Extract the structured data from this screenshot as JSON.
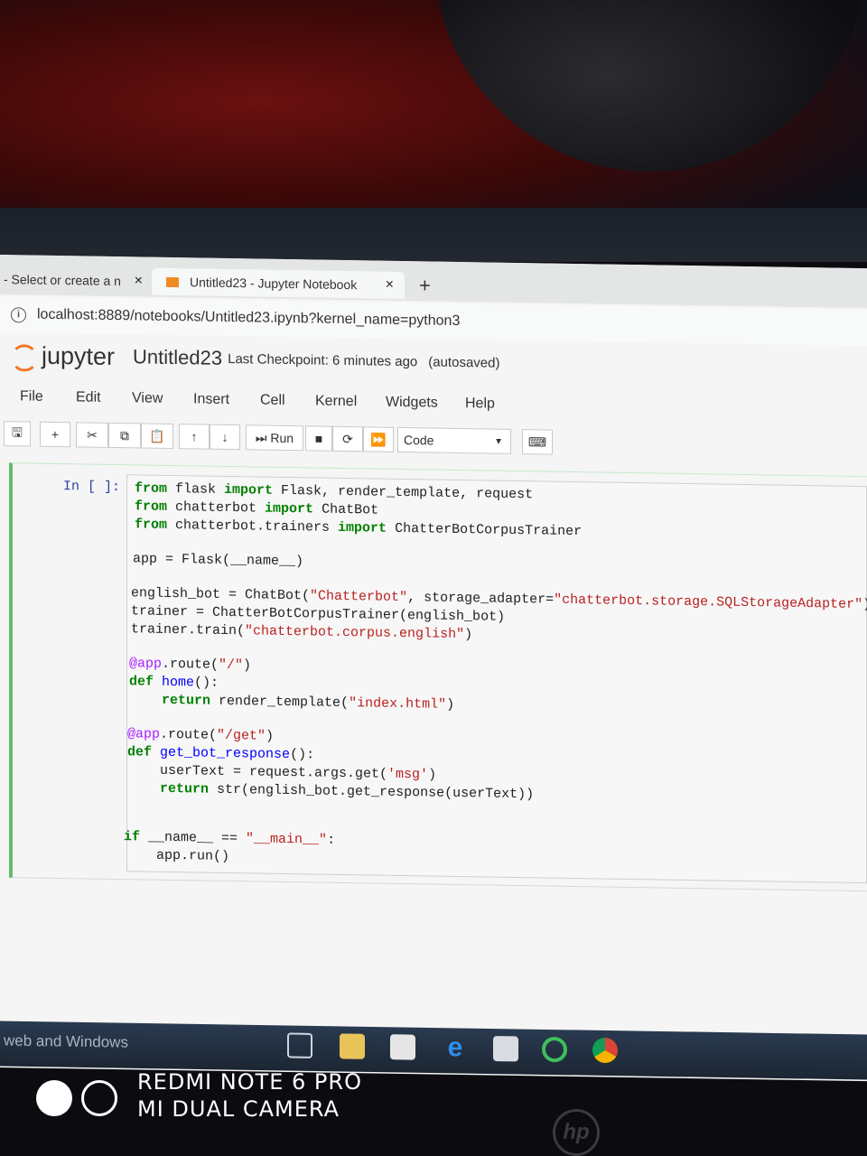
{
  "browser": {
    "tabs": [
      {
        "label": "- Select or create a n",
        "close": "×"
      },
      {
        "label": "Untitled23 - Jupyter Notebook",
        "close": "×"
      }
    ],
    "new_tab": "+",
    "url": "localhost:8889/notebooks/Untitled23.ipynb?kernel_name=python3"
  },
  "jupyter": {
    "logo_text": "jupyter",
    "notebook_title": "Untitled23",
    "checkpoint": "Last Checkpoint: 6 minutes ago",
    "autosave": "(autosaved)",
    "menu": [
      "File",
      "Edit",
      "View",
      "Insert",
      "Cell",
      "Kernel",
      "Widgets",
      "Help"
    ],
    "toolbar": {
      "run_label": "Run",
      "cell_type": "Code"
    }
  },
  "cell": {
    "prompt": "In [ ]:",
    "code": {
      "l1": [
        "from",
        " flask ",
        "import",
        " Flask, render_template, request"
      ],
      "l2": [
        "from",
        " chatterbot ",
        "import",
        " ChatBot"
      ],
      "l3": [
        "from",
        " chatterbot.trainers ",
        "import",
        " ChatterBotCorpusTrainer"
      ],
      "l4": "app = Flask(__name__)",
      "l5": [
        "english_bot = ChatBot(",
        "\"Chatterbot\"",
        ", storage_adapter=",
        "\"chatterbot.storage.SQLStorageAdapter\"",
        ")"
      ],
      "l6": "trainer = ChatterBotCorpusTrainer(english_bot)",
      "l7": [
        "trainer.train(",
        "\"chatterbot.corpus.english\"",
        ")"
      ],
      "l8": [
        "@app",
        ".route(",
        "\"/\"",
        ")"
      ],
      "l9": [
        "def",
        " ",
        "home",
        "():"
      ],
      "l10": [
        "    ",
        "return",
        " render_template(",
        "\"index.html\"",
        ")"
      ],
      "l11": [
        "@app",
        ".route(",
        "\"/get\"",
        ")"
      ],
      "l12": [
        "def",
        " ",
        "get_bot_response",
        "():"
      ],
      "l13": [
        "    userText = request.args.get(",
        "'msg'",
        ")"
      ],
      "l14": [
        "    ",
        "return",
        " str(english_bot.get_response(userText))"
      ],
      "l15": [
        "if",
        " __name__ == ",
        "\"__main__\"",
        ":"
      ],
      "l16": "    app.run()"
    }
  },
  "taskbar": {
    "search_text": "web and Windows"
  },
  "watermark": {
    "line1": "REDMI NOTE 6 PRO",
    "line2": "MI DUAL CAMERA"
  },
  "hp_logo": "hp"
}
